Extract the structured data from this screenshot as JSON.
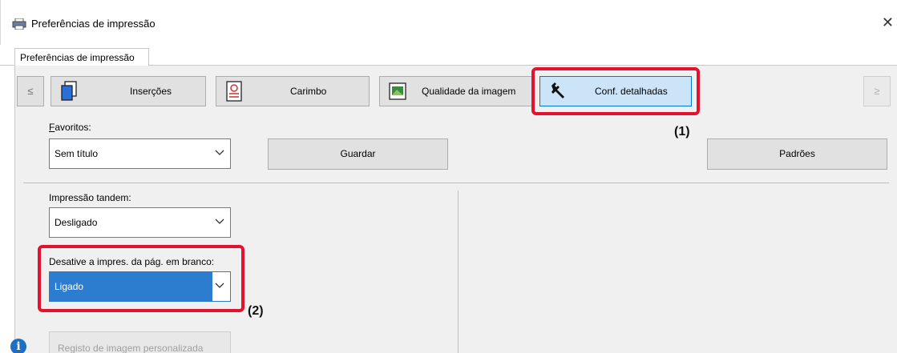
{
  "window": {
    "title": "Preferências de impressão",
    "close_glyph": "✕"
  },
  "tabs": [
    {
      "label": "Preferências de impressão"
    }
  ],
  "nav": {
    "prev_glyph": "≤",
    "next_glyph": "≥",
    "buttons": [
      {
        "label": "Inserções",
        "icon": "inserts-icon"
      },
      {
        "label": "Carimbo",
        "icon": "stamp-icon"
      },
      {
        "label": "Qualidade da imagem",
        "icon": "image-quality-icon"
      },
      {
        "label": "Conf. detalhadas",
        "icon": "wrench-icon",
        "active": true
      }
    ]
  },
  "favorites": {
    "label": "Favoritos:",
    "value": "Sem título",
    "save_label": "Guardar",
    "defaults_label": "Padrões"
  },
  "tandem": {
    "label": "Impressão tandem:",
    "value": "Desligado"
  },
  "blank_page": {
    "label": "Desative a impres. da pág. em branco:",
    "value": "Ligado"
  },
  "custom_image": {
    "label": "Registo de imagem personalizada"
  },
  "callouts": {
    "one": "(1)",
    "two": "(2)"
  },
  "colors": {
    "highlight_red": "#e3112d",
    "selection_blue": "#2c7cd0",
    "active_button": "#cce4f7"
  }
}
